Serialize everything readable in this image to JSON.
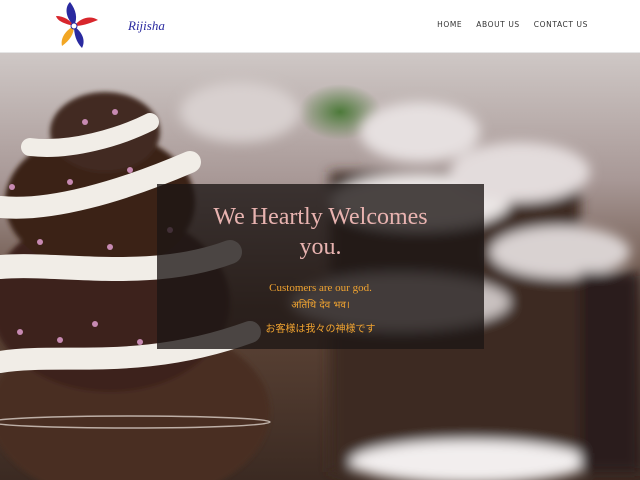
{
  "brand": {
    "logo_text": "Rijisha"
  },
  "nav": {
    "items": [
      {
        "label": "HOME"
      },
      {
        "label": "ABOUT US"
      },
      {
        "label": "CONTACT US"
      }
    ]
  },
  "hero": {
    "title_line1": "We Heartly Welcomes",
    "title_line2": "you.",
    "tagline_en": "Customers are our god.",
    "tagline_hi": "अतिथि देव भव।",
    "tagline_ja": "お客様は我々の神様です"
  },
  "colors": {
    "title": "#e8b3b0",
    "tagline": "#f0a330",
    "overlay": "#1c1614"
  }
}
